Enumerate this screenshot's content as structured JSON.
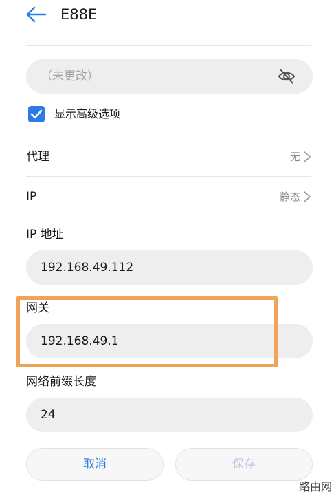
{
  "header": {
    "back_icon": "back-arrow-icon",
    "title": "E88E"
  },
  "password": {
    "placeholder": "（未更改）",
    "visibility_icon": "eye-off-icon"
  },
  "advanced": {
    "checked": true,
    "label": "显示高级选项"
  },
  "proxy": {
    "label": "代理",
    "value": "无"
  },
  "ip_mode": {
    "label": "IP",
    "value": "静态"
  },
  "ip_address": {
    "label": "IP 地址",
    "value": "192.168.49.112"
  },
  "gateway": {
    "label": "网关",
    "value": "192.168.49.1"
  },
  "prefix_length": {
    "label": "网络前缀长度",
    "value": "24"
  },
  "buttons": {
    "cancel": "取消",
    "save": "保存"
  },
  "watermark": "路由网",
  "colors": {
    "accent": "#2c7be5",
    "highlight": "#f0a45a",
    "field_bg": "#eeeeee"
  }
}
